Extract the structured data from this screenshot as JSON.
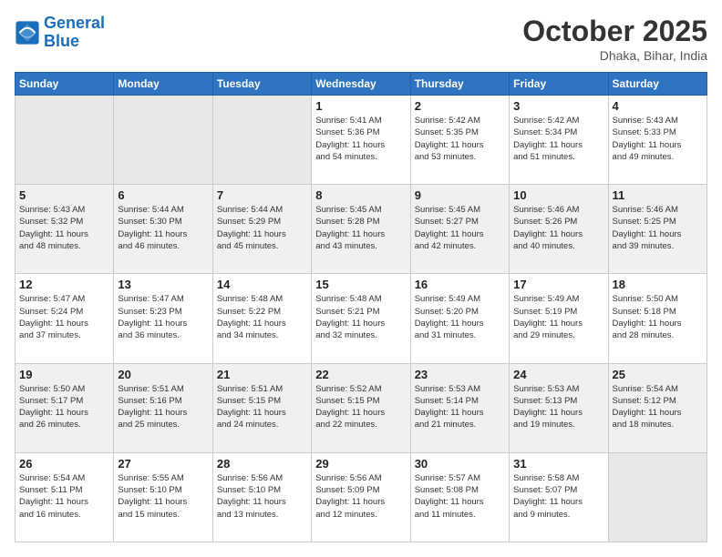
{
  "header": {
    "logo_line1": "General",
    "logo_line2": "Blue",
    "month": "October 2025",
    "location": "Dhaka, Bihar, India"
  },
  "weekdays": [
    "Sunday",
    "Monday",
    "Tuesday",
    "Wednesday",
    "Thursday",
    "Friday",
    "Saturday"
  ],
  "weeks": [
    [
      {
        "day": "",
        "info": ""
      },
      {
        "day": "",
        "info": ""
      },
      {
        "day": "",
        "info": ""
      },
      {
        "day": "1",
        "info": "Sunrise: 5:41 AM\nSunset: 5:36 PM\nDaylight: 11 hours\nand 54 minutes."
      },
      {
        "day": "2",
        "info": "Sunrise: 5:42 AM\nSunset: 5:35 PM\nDaylight: 11 hours\nand 53 minutes."
      },
      {
        "day": "3",
        "info": "Sunrise: 5:42 AM\nSunset: 5:34 PM\nDaylight: 11 hours\nand 51 minutes."
      },
      {
        "day": "4",
        "info": "Sunrise: 5:43 AM\nSunset: 5:33 PM\nDaylight: 11 hours\nand 49 minutes."
      }
    ],
    [
      {
        "day": "5",
        "info": "Sunrise: 5:43 AM\nSunset: 5:32 PM\nDaylight: 11 hours\nand 48 minutes."
      },
      {
        "day": "6",
        "info": "Sunrise: 5:44 AM\nSunset: 5:30 PM\nDaylight: 11 hours\nand 46 minutes."
      },
      {
        "day": "7",
        "info": "Sunrise: 5:44 AM\nSunset: 5:29 PM\nDaylight: 11 hours\nand 45 minutes."
      },
      {
        "day": "8",
        "info": "Sunrise: 5:45 AM\nSunset: 5:28 PM\nDaylight: 11 hours\nand 43 minutes."
      },
      {
        "day": "9",
        "info": "Sunrise: 5:45 AM\nSunset: 5:27 PM\nDaylight: 11 hours\nand 42 minutes."
      },
      {
        "day": "10",
        "info": "Sunrise: 5:46 AM\nSunset: 5:26 PM\nDaylight: 11 hours\nand 40 minutes."
      },
      {
        "day": "11",
        "info": "Sunrise: 5:46 AM\nSunset: 5:25 PM\nDaylight: 11 hours\nand 39 minutes."
      }
    ],
    [
      {
        "day": "12",
        "info": "Sunrise: 5:47 AM\nSunset: 5:24 PM\nDaylight: 11 hours\nand 37 minutes."
      },
      {
        "day": "13",
        "info": "Sunrise: 5:47 AM\nSunset: 5:23 PM\nDaylight: 11 hours\nand 36 minutes."
      },
      {
        "day": "14",
        "info": "Sunrise: 5:48 AM\nSunset: 5:22 PM\nDaylight: 11 hours\nand 34 minutes."
      },
      {
        "day": "15",
        "info": "Sunrise: 5:48 AM\nSunset: 5:21 PM\nDaylight: 11 hours\nand 32 minutes."
      },
      {
        "day": "16",
        "info": "Sunrise: 5:49 AM\nSunset: 5:20 PM\nDaylight: 11 hours\nand 31 minutes."
      },
      {
        "day": "17",
        "info": "Sunrise: 5:49 AM\nSunset: 5:19 PM\nDaylight: 11 hours\nand 29 minutes."
      },
      {
        "day": "18",
        "info": "Sunrise: 5:50 AM\nSunset: 5:18 PM\nDaylight: 11 hours\nand 28 minutes."
      }
    ],
    [
      {
        "day": "19",
        "info": "Sunrise: 5:50 AM\nSunset: 5:17 PM\nDaylight: 11 hours\nand 26 minutes."
      },
      {
        "day": "20",
        "info": "Sunrise: 5:51 AM\nSunset: 5:16 PM\nDaylight: 11 hours\nand 25 minutes."
      },
      {
        "day": "21",
        "info": "Sunrise: 5:51 AM\nSunset: 5:15 PM\nDaylight: 11 hours\nand 24 minutes."
      },
      {
        "day": "22",
        "info": "Sunrise: 5:52 AM\nSunset: 5:15 PM\nDaylight: 11 hours\nand 22 minutes."
      },
      {
        "day": "23",
        "info": "Sunrise: 5:53 AM\nSunset: 5:14 PM\nDaylight: 11 hours\nand 21 minutes."
      },
      {
        "day": "24",
        "info": "Sunrise: 5:53 AM\nSunset: 5:13 PM\nDaylight: 11 hours\nand 19 minutes."
      },
      {
        "day": "25",
        "info": "Sunrise: 5:54 AM\nSunset: 5:12 PM\nDaylight: 11 hours\nand 18 minutes."
      }
    ],
    [
      {
        "day": "26",
        "info": "Sunrise: 5:54 AM\nSunset: 5:11 PM\nDaylight: 11 hours\nand 16 minutes."
      },
      {
        "day": "27",
        "info": "Sunrise: 5:55 AM\nSunset: 5:10 PM\nDaylight: 11 hours\nand 15 minutes."
      },
      {
        "day": "28",
        "info": "Sunrise: 5:56 AM\nSunset: 5:10 PM\nDaylight: 11 hours\nand 13 minutes."
      },
      {
        "day": "29",
        "info": "Sunrise: 5:56 AM\nSunset: 5:09 PM\nDaylight: 11 hours\nand 12 minutes."
      },
      {
        "day": "30",
        "info": "Sunrise: 5:57 AM\nSunset: 5:08 PM\nDaylight: 11 hours\nand 11 minutes."
      },
      {
        "day": "31",
        "info": "Sunrise: 5:58 AM\nSunset: 5:07 PM\nDaylight: 11 hours\nand 9 minutes."
      },
      {
        "day": "",
        "info": ""
      }
    ]
  ]
}
